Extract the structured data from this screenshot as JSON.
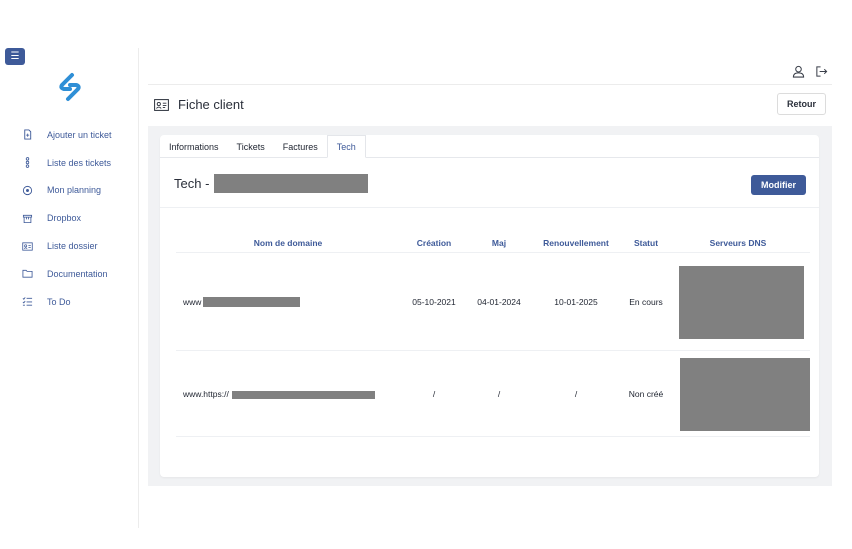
{
  "sidebar": {
    "menu_icon": "hamburger-icon",
    "logo_icon": "app-logo",
    "items": [
      {
        "label": "Ajouter un ticket",
        "icon": "document-add-icon"
      },
      {
        "label": "Liste des tickets",
        "icon": "ticket-list-icon"
      },
      {
        "label": "Mon planning",
        "icon": "target-icon"
      },
      {
        "label": "Dropbox",
        "icon": "box-icon"
      },
      {
        "label": "Liste dossier",
        "icon": "id-card-icon"
      },
      {
        "label": "Documentation",
        "icon": "folder-icon"
      },
      {
        "label": "To Do",
        "icon": "checklist-icon"
      }
    ]
  },
  "header": {
    "title": "Fiche client",
    "back_label": "Retour",
    "user_icon": "user-icon",
    "logout_icon": "logout-icon"
  },
  "tabs": [
    {
      "label": "Informations",
      "active": false
    },
    {
      "label": "Tickets",
      "active": false
    },
    {
      "label": "Factures",
      "active": false
    },
    {
      "label": "Tech",
      "active": true
    }
  ],
  "tech": {
    "title": "Tech -",
    "edit_label": "Modifier"
  },
  "table": {
    "columns": [
      "Nom de domaine",
      "Création",
      "Maj",
      "Renouvellement",
      "Statut",
      "Serveurs DNS"
    ],
    "rows": [
      {
        "domain": "www",
        "creation": "05-10-2021",
        "maj": "04-01-2024",
        "renouvellement": "10-01-2025",
        "statut": "En cours"
      },
      {
        "domain": "www.https://",
        "creation": "/",
        "maj": "/",
        "renouvellement": "/",
        "statut": "Non créé"
      }
    ]
  },
  "colors": {
    "accent": "#3e5a99",
    "logo": "#2f8fd6",
    "redaction": "#808080",
    "panel_bg": "#f1f2f4"
  }
}
